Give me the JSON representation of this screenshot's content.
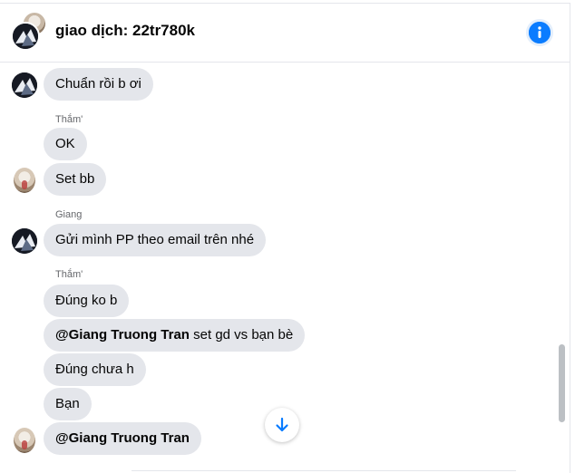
{
  "header": {
    "title": "giao dịch: 22tr780k",
    "info_icon": "info-icon"
  },
  "messages": [
    {
      "text": "Chuẩn rồi b ơi",
      "avatar": "dark"
    },
    {
      "sender": "Thắm'",
      "text": "OK"
    },
    {
      "text": "Set bb",
      "avatar": "light"
    },
    {
      "sender": "Giang",
      "text": "Gửi mình PP theo email trên nhé",
      "avatar": "dark"
    },
    {
      "sender": "Thắm'",
      "text": "Đúng ko b"
    },
    {
      "mention": "@Giang Truong Tran",
      "text": " set gd vs bạn bè"
    },
    {
      "text": "Đúng chưa h"
    },
    {
      "text": "Bạn"
    },
    {
      "mention": "@Giang Truong Tran",
      "avatar": "light"
    }
  ],
  "colors": {
    "accent": "#0a7cff",
    "bubble": "#e4e6eb",
    "text": "#050505",
    "secondary_text": "#65676b"
  },
  "scroll_down_icon": "arrow-down-icon"
}
